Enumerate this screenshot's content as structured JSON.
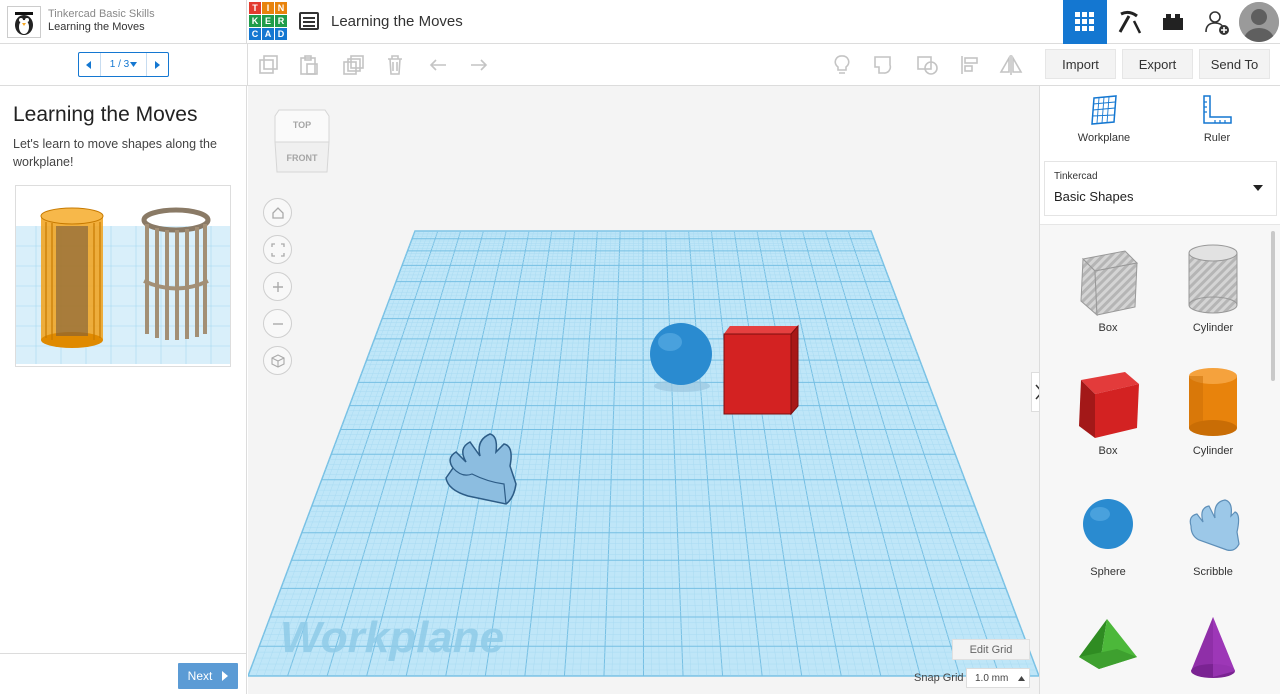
{
  "header": {
    "course": "Tinkercad Basic Skills",
    "lesson": "Learning the Moves",
    "logo_letters": [
      "T",
      "I",
      "N",
      "K",
      "E",
      "R",
      "C",
      "A",
      "D"
    ],
    "document_title": "Learning the Moves"
  },
  "lesson_nav": {
    "page": "1 / 3"
  },
  "actions": {
    "import": "Import",
    "export": "Export",
    "send_to": "Send To"
  },
  "lesson": {
    "title": "Learning the Moves",
    "text": "Let's learn to move shapes along the workplane!",
    "next": "Next"
  },
  "viewcube": {
    "top": "TOP",
    "front": "FRONT"
  },
  "workplane": {
    "watermark": "Workplane"
  },
  "grid": {
    "edit": "Edit Grid",
    "snap_label": "Snap Grid",
    "snap_value": "1.0 mm"
  },
  "right_tools": {
    "workplane": "Workplane",
    "ruler": "Ruler"
  },
  "library": {
    "provider": "Tinkercad",
    "category": "Basic Shapes"
  },
  "shapes": [
    {
      "label": "Box"
    },
    {
      "label": "Cylinder"
    },
    {
      "label": "Box"
    },
    {
      "label": "Cylinder"
    },
    {
      "label": "Sphere"
    },
    {
      "label": "Scribble"
    }
  ],
  "colors": {
    "accent": "#1477d1",
    "grid": "#8fd0ef",
    "box_red": "#d32222",
    "sphere_blue": "#2a8bd0",
    "cylinder_orange": "#e8830c"
  }
}
